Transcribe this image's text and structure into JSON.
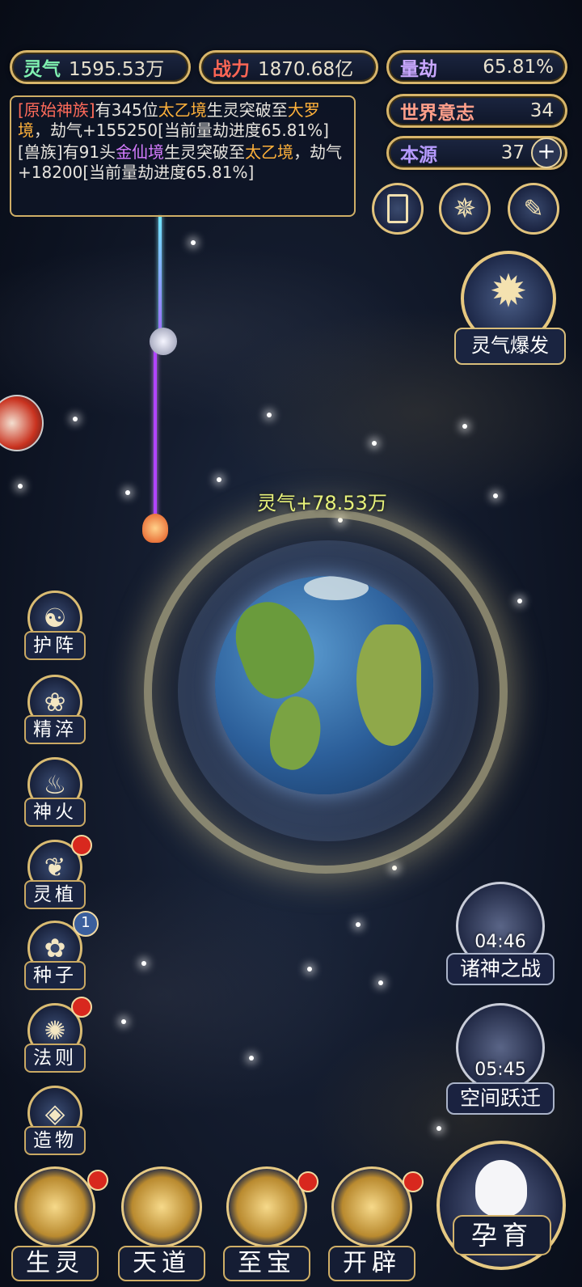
{
  "stats": {
    "lingqi": {
      "label": "灵气",
      "value": "1595.53万"
    },
    "zhanli": {
      "label": "战力",
      "value": "1870.68亿"
    },
    "liangjie": {
      "label": "量劫",
      "value": "65.81%"
    },
    "shijie": {
      "label": "世界意志",
      "value": "34"
    },
    "benyuan": {
      "label": "本源",
      "value": "37",
      "plus": "+"
    }
  },
  "log": {
    "entry1": {
      "faction": "[原始神族]",
      "t1": "有345位",
      "realm1": "太乙境",
      "t2": "生灵突破至",
      "realm2": "大罗境",
      "t3": "，劫气+155250[当前量劫进度65.81%]"
    },
    "entry2": {
      "faction": "[兽族]",
      "t1": "有91头",
      "realm1": "金仙境",
      "t2": "生灵突破至",
      "realm2": "太乙境",
      "t3": "，劫气+18200[当前量劫进度65.81%]"
    }
  },
  "burst_label": "灵气爆发",
  "gain_text": "灵气+78.53万",
  "side_menu": [
    {
      "label": "护阵",
      "icon": "☯",
      "badge": ""
    },
    {
      "label": "精淬",
      "icon": "❀",
      "badge": ""
    },
    {
      "label": "神火",
      "icon": "♨",
      "badge": ""
    },
    {
      "label": "灵植",
      "icon": "❦",
      "badge": "dot"
    },
    {
      "label": "种子",
      "icon": "✿",
      "badge": "1"
    },
    {
      "label": "法则",
      "icon": "✺",
      "badge": "dot"
    },
    {
      "label": "造物",
      "icon": "◈",
      "badge": ""
    }
  ],
  "events": [
    {
      "label": "诸神之战",
      "time": "04:46"
    },
    {
      "label": "空间跃迁",
      "time": "05:45"
    }
  ],
  "bottom_menu": [
    {
      "label": "生灵",
      "badge": "dot"
    },
    {
      "label": "天道",
      "badge": ""
    },
    {
      "label": "至宝",
      "badge": "dot"
    },
    {
      "label": "开辟",
      "badge": "dot"
    }
  ],
  "main_action": "孕育",
  "colors": {
    "accent": "#d7b56a",
    "lingqi": "#7ff0b0",
    "zhanli": "#ff6655",
    "liangjie": "#c9a8ff",
    "shijie": "#ff9f8a",
    "benyuan": "#b69bff"
  }
}
